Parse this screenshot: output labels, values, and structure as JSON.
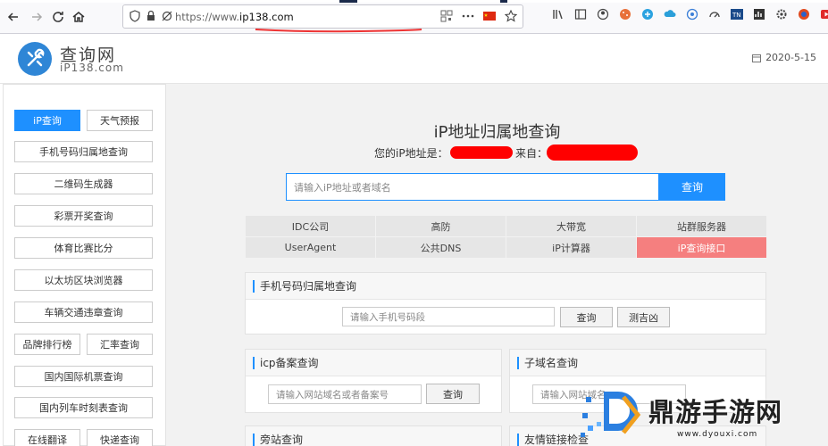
{
  "browser": {
    "url_prefix": "https://www.",
    "url_domain": "ip138.com"
  },
  "header": {
    "logo_title": "查询网",
    "logo_sub": "iP138.com",
    "date": "2020-5-15"
  },
  "sidebar": {
    "items": [
      {
        "label": "iP查询",
        "active": true
      },
      {
        "label": "天气预报"
      },
      {
        "label": "手机号码归属地查询"
      },
      {
        "label": "二维码生成器"
      },
      {
        "label": "彩票开奖查询"
      },
      {
        "label": "体育比赛比分"
      },
      {
        "label": "以太坊区块浏览器"
      },
      {
        "label": "车辆交通违章查询"
      },
      {
        "label": "品牌排行榜"
      },
      {
        "label": "汇率查询"
      },
      {
        "label": "国内国际机票查询"
      },
      {
        "label": "国内列车时刻表查询"
      },
      {
        "label": "在线翻译"
      },
      {
        "label": "快递查询"
      }
    ]
  },
  "main": {
    "title": "iP地址归属地查询",
    "your_ip_label": "您的iP地址是：",
    "from_label": "来自：",
    "search_placeholder": "请输入iP地址或者域名",
    "search_button": "查询",
    "links": [
      {
        "label": "IDC公司"
      },
      {
        "label": "高防"
      },
      {
        "label": "大带宽"
      },
      {
        "label": "站群服务器"
      },
      {
        "label": "UserAgent"
      },
      {
        "label": "公共DNS"
      },
      {
        "label": "iP计算器"
      },
      {
        "label": "iP查询接口",
        "highlight": true
      }
    ],
    "phone_panel": {
      "title": "手机号码归属地查询",
      "placeholder": "请输入手机号码段",
      "query_button": "查询",
      "luck_button": "测吉凶"
    },
    "icp_panel": {
      "title": "icp备案查询",
      "placeholder": "请输入网站域名或者备案号",
      "query_button": "查询"
    },
    "subdomain_panel": {
      "title": "子域名查询",
      "placeholder": "请输入网站域名"
    },
    "sidesite_panel": {
      "title": "旁站查询"
    },
    "friendlink_panel": {
      "title": "友情链接检查"
    }
  },
  "watermark": {
    "text": "鼎游手游网",
    "url": "www.dyouxi.com"
  },
  "colors": {
    "accent": "#1e90ff",
    "highlight": "#f57f7f",
    "redaction": "#ff0000"
  }
}
